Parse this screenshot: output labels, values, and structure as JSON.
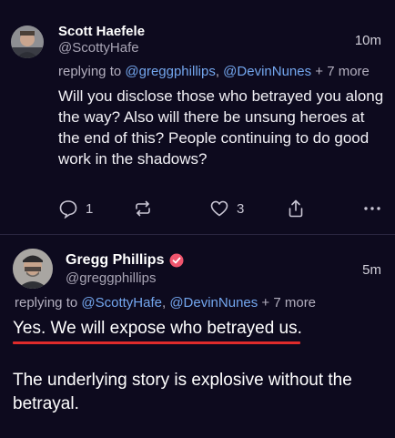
{
  "post1": {
    "author_name": "Scott Haefele",
    "author_handle": "@ScottyHafe",
    "timestamp": "10m",
    "reply_prefix": "replying to ",
    "reply_mentions": [
      "@greggphillips",
      "@DevinNunes"
    ],
    "reply_separator": ", ",
    "reply_more": " + 7 more",
    "body": "Will you disclose those who betrayed you along the way? Also will there be unsung heroes at the end of this? People continuing to do good work in the shadows?",
    "actions": {
      "reply_icon": "reply-icon",
      "reply_count": "1",
      "repost_icon": "repost-icon",
      "like_icon": "heart-icon",
      "like_count": "3",
      "share_icon": "share-icon",
      "more_icon": "more-icon"
    }
  },
  "post2": {
    "author_name": "Gregg Phillips",
    "author_handle": "@greggphillips",
    "verified_icon": "verified-badge-icon",
    "timestamp": "5m",
    "reply_prefix": "replying to ",
    "reply_mentions": [
      "@ScottyHafe",
      "@DevinNunes"
    ],
    "reply_separator": ", ",
    "reply_more": " + 7 more",
    "body_line1": "Yes. We will expose who betrayed us.",
    "body_line2": "The underlying story is explosive without the betrayal."
  },
  "colors": {
    "background": "#0d0a1e",
    "mention": "#73a6ee",
    "underline_annotation": "#e02b2b",
    "verified_badge": "#f0556e"
  }
}
